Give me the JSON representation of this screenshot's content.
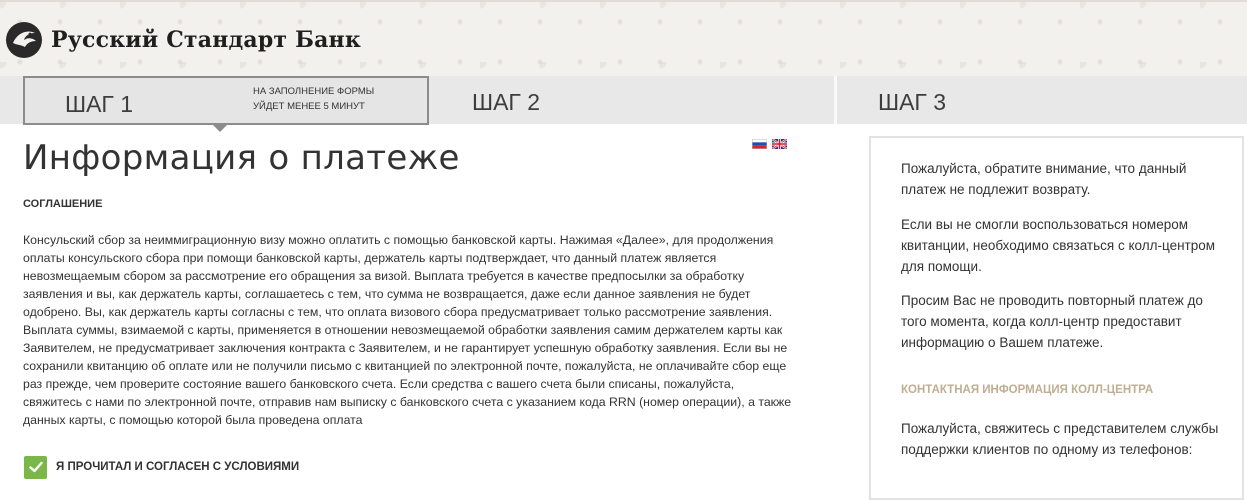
{
  "header": {
    "logo_text": "Русский Стандарт Банк"
  },
  "steps": [
    {
      "label": "ШАГ 1",
      "note_line1": "НА ЗАПОЛНЕНИЕ ФОРМЫ",
      "note_line2": "УЙДЕТ МЕНЕЕ 5 МИНУТ",
      "active": true
    },
    {
      "label": "ШАГ 2",
      "active": false
    },
    {
      "label": "ШАГ 3",
      "active": false
    }
  ],
  "languages": [
    "ru",
    "en"
  ],
  "main": {
    "title": "Информация о платеже",
    "section_heading": "СОГЛАШЕНИЕ",
    "agreement_text": "Консульский сбор за неиммиграционную визу можно оплатить с помощью банковской карты. Нажимая «Далее», для продолжения оплаты консульского сбора при помощи банковской карты, держатель карты подтверждает, что данный платеж является невозмещаемым сбором за рассмотрение его обращения за визой. Выплата требуется в качестве предпосылки за обработку заявления и вы, как держатель карты, соглашаетесь с тем, что сумма не возвращается, даже если данное заявления не будет одобрено. Вы, как держатель карты согласны с тем, что оплата визового сбора предусматривает только рассмотрение заявления. Выплата суммы, взимаемой с карты, применяется в отношении невозмещаемой обработки заявления самим держателем карты как Заявителем, не предусматривает заключения контракта с Заявителем, и не гарантирует успешную обработку заявления. Если вы не сохранили квитанцию об оплате или не получили письмо с квитанцией по электронной почте, пожалуйста, не оплачивайте сбор еще раз прежде, чем проверите состояние вашего банковского счета. Если средства с вашего счета были списаны, пожалуйста, свяжитесь с нами по электронной почте, отправив нам выписку с банковского счета с указанием кода RRN (номер операции), а также данных карты, с помощью которой была проведена оплата",
    "agree_checkbox": {
      "label": "Я ПРОЧИТАЛ И СОГЛАСЕН С УСЛОВИЯМИ",
      "checked": true
    }
  },
  "info_panel": {
    "p1": "Пожалуйста, обратите внимание, что данный платеж не подлежит возврату.",
    "p2": "Если вы не смогли воспользоваться номером квитанции, необходимо связаться с колл-центром для помощи.",
    "p3": "Просим Вас не проводить повторный платеж до того момента, когда колл-центр предоставит информацию о Вашем платеже.",
    "contact_heading": "КОНТАКТНАЯ ИНФОРМАЦИЯ КОЛЛ-ЦЕНТРА",
    "p4": "Пожалуйста, свяжитесь с представителем службы поддержки клиентов по одному из телефонов:"
  },
  "colors": {
    "checkbox_green": "#7ab648",
    "contact_heading": "#bfae92",
    "step_border": "#8c8c8c",
    "steps_bg": "#e8e8e8"
  }
}
